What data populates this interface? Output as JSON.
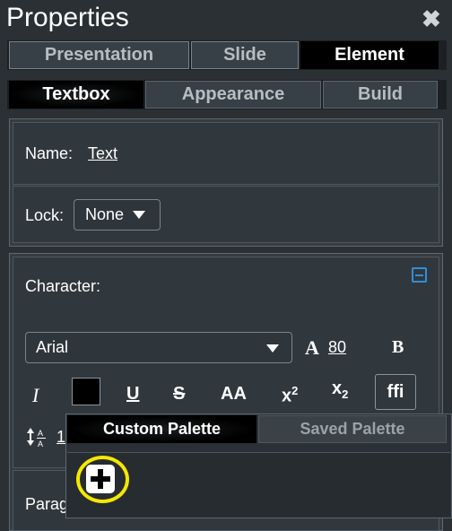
{
  "window": {
    "title": "Properties",
    "close_icon": "close-icon"
  },
  "tabs": [
    {
      "label": "Presentation",
      "active": false
    },
    {
      "label": "Slide",
      "active": false
    },
    {
      "label": "Element",
      "active": true
    }
  ],
  "subtabs": [
    {
      "label": "Textbox",
      "active": true
    },
    {
      "label": "Appearance",
      "active": false
    },
    {
      "label": "Build",
      "active": false
    }
  ],
  "name": {
    "label": "Name:",
    "value": "Text"
  },
  "lock": {
    "label": "Lock:",
    "value": "None"
  },
  "character": {
    "label": "Character:",
    "font": "Arial",
    "size_glyph": "A",
    "size": "80",
    "bold": "B",
    "italic": "I",
    "underline": "U",
    "strike": "S",
    "caps": "AA",
    "superscript_base": "x",
    "superscript_mark": "2",
    "subscript_base": "x",
    "subscript_mark": "2",
    "ligature": "ffi",
    "text_color": "#000000",
    "line_spacing_value": "1"
  },
  "palette": {
    "tabs": [
      {
        "label": "Custom Palette",
        "active": true
      },
      {
        "label": "Saved Palette",
        "active": false
      }
    ],
    "add_icon": "plus-icon"
  },
  "paragraph": {
    "label": "Parag"
  },
  "colors": {
    "highlight_ring": "#f5e800",
    "collapse_icon": "#2f8fd8"
  }
}
